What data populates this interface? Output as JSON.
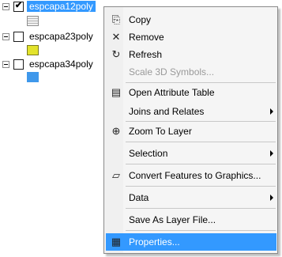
{
  "toc": {
    "layers": [
      {
        "name": "espcapa12poly",
        "checked": true,
        "selected": true,
        "symbol": "grey-striped-swatch"
      },
      {
        "name": "espcapa23poly",
        "checked": false,
        "selected": false,
        "symbol": "yellow-swatch"
      },
      {
        "name": "espcapa34poly",
        "checked": false,
        "selected": false,
        "symbol": "blue-swatch"
      }
    ],
    "check_glyph": "✔"
  },
  "menu": {
    "items": [
      {
        "label": "Copy",
        "icon": "copy-icon",
        "glyph": "⎘"
      },
      {
        "label": "Remove",
        "icon": "remove-icon",
        "glyph": "✕"
      },
      {
        "label": "Refresh",
        "icon": "refresh-icon",
        "glyph": "↻"
      },
      {
        "label": "Scale 3D Symbols...",
        "icon": "",
        "disabled": true
      },
      {
        "label": "Open Attribute Table",
        "icon": "table-icon",
        "glyph": "▤"
      },
      {
        "label": "Joins and Relates",
        "submenu": true
      },
      {
        "label": "Zoom To Layer",
        "icon": "zoom-to-layer-icon",
        "glyph": "⊕"
      },
      {
        "label": "Selection",
        "submenu": true
      },
      {
        "label": "Convert Features to Graphics...",
        "icon": "convert-graphics-icon",
        "glyph": "▱"
      },
      {
        "label": "Data",
        "submenu": true
      },
      {
        "label": "Save As Layer File..."
      },
      {
        "label": "Properties...",
        "icon": "properties-icon",
        "glyph": "▦",
        "highlighted": true
      }
    ]
  },
  "colors": {
    "selection_blue": "#3399ff",
    "yellow_swatch": "#e3e32b",
    "blue_swatch": "#3f98eb"
  }
}
